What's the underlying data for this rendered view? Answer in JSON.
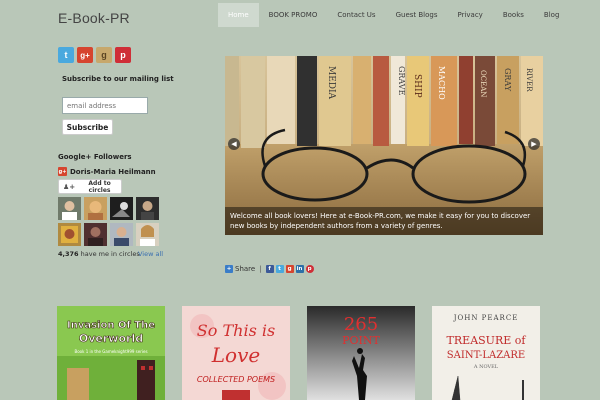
{
  "site": {
    "title": "E-Book-PR"
  },
  "nav": [
    {
      "label": "Home",
      "active": true
    },
    {
      "label": "BOOK PROMO"
    },
    {
      "label": "Contact Us"
    },
    {
      "label": "Guest Blogs"
    },
    {
      "label": "Privacy"
    },
    {
      "label": "Books"
    },
    {
      "label": "Blog"
    }
  ],
  "social": {
    "twitter": "t",
    "gplus": "g+",
    "goodreads": "g",
    "pinterest": "p"
  },
  "mailing": {
    "title": "Subscribe to our mailing list",
    "placeholder": "email address",
    "button": "Subscribe"
  },
  "gplus_widget": {
    "title": "Google+ Followers",
    "user": "Doris-Maria Heilmann",
    "add_button": "Add to circles",
    "count": "4,376",
    "count_text": "have me in circles",
    "view_all": "View all"
  },
  "slider": {
    "caption": "Welcome all book lovers! Here at e-Book-PR.com, we make it easy for you to discover new books by independent authors from a variety of genres.",
    "spines": [
      "MEDIA",
      "GRAVE",
      "SHIP",
      "MACHO",
      "OCEAN",
      "GRAY",
      "RIVER"
    ]
  },
  "share": {
    "label": "Share",
    "sep": "|"
  },
  "books": [
    {
      "title_line1": "Invasion Of The",
      "title_line2": "Overworld",
      "subtitle": "Book 1 in the Gameknight999 series"
    },
    {
      "title_line1": "So This is",
      "title_line2": "Love",
      "subtitle": "COLLECTED POEMS"
    },
    {
      "title_line1": "265",
      "title_line2": "POINT"
    },
    {
      "author": "JOHN PEARCE",
      "title_line1": "TREASURE of",
      "title_line2": "SAINT-LAZARE",
      "subtitle": "A NOVEL"
    }
  ],
  "colors": {
    "background": "#b9c7b8",
    "nav_active": "#cfd9cf",
    "link": "#3a6fb0"
  }
}
